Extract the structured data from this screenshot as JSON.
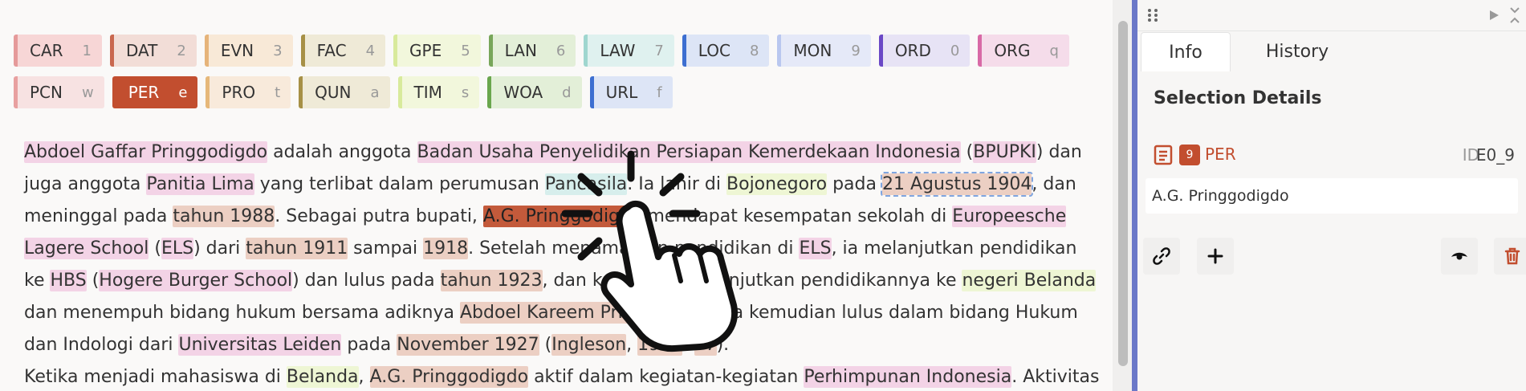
{
  "labels": [
    [
      {
        "name": "CAR",
        "key": "1",
        "color": "#f7d6d6",
        "border": "#e59a9a"
      },
      {
        "name": "DAT",
        "key": "2",
        "color": "#f2ddd7",
        "border": "#c9684f"
      },
      {
        "name": "EVN",
        "key": "3",
        "color": "#f8e9d7",
        "border": "#e6b47a"
      },
      {
        "name": "FAC",
        "key": "4",
        "color": "#efead7",
        "border": "#a69046"
      },
      {
        "name": "GPE",
        "key": "5",
        "color": "#f2f7dc",
        "border": "#d8ea9c"
      },
      {
        "name": "LAN",
        "key": "6",
        "color": "#e3efd8",
        "border": "#78a65a"
      },
      {
        "name": "LAW",
        "key": "7",
        "color": "#dff1ef",
        "border": "#9fd6cf"
      },
      {
        "name": "LOC",
        "key": "8",
        "color": "#dde5f6",
        "border": "#3d6fd1"
      },
      {
        "name": "MON",
        "key": "9",
        "color": "#e5e9f8",
        "border": "#b9c7ef"
      },
      {
        "name": "ORD",
        "key": "0",
        "color": "#e7e3f5",
        "border": "#6a48c6"
      },
      {
        "name": "ORG",
        "key": "q",
        "color": "#f5dcea",
        "border": "#d86aa6"
      }
    ],
    [
      {
        "name": "PCN",
        "key": "w",
        "color": "#f7e2e2",
        "border": "#e8a0a0"
      },
      {
        "name": "PER",
        "key": "e",
        "color": "#c24e2f",
        "border": "#c24e2f",
        "selected": true
      },
      {
        "name": "PRO",
        "key": "t",
        "color": "#f8eadb",
        "border": "#e6b87a"
      },
      {
        "name": "QUN",
        "key": "a",
        "color": "#efead7",
        "border": "#a69046"
      },
      {
        "name": "TIM",
        "key": "s",
        "color": "#f2f7dc",
        "border": "#d8ea9c"
      },
      {
        "name": "WOA",
        "key": "d",
        "color": "#e3efd8",
        "border": "#6aa64e"
      },
      {
        "name": "URL",
        "key": "f",
        "color": "#dde5f6",
        "border": "#3d6fd1"
      }
    ]
  ],
  "text": {
    "l1": [
      "Abdoel Gaffar Pringgodigdo",
      " adalah anggota ",
      "Badan Usaha Penyelidikan Persiapan Kemerdekaan Indonesia",
      " (",
      "BPUPKI",
      ") dan"
    ],
    "l2": [
      "juga anggota ",
      "Panitia Lima",
      " yang terlibat dalam perumusan ",
      "Pancasila",
      ". Ia lahir di ",
      "Bojonegoro",
      " pada ",
      "21 Agustus 1904",
      ", dan"
    ],
    "l3": [
      "meninggal pada ",
      "tahun 1988",
      ". Sebagai putra bupati, ",
      "A.G. Pringgodigdo",
      " mendapat kesempatan sekolah di ",
      "Europeesche"
    ],
    "l4": [
      "Lagere School",
      " (",
      "ELS",
      ") dari ",
      "tahun 1911",
      " sampai ",
      "1918",
      ". Setelah menamatkan pendidikan di ",
      "ELS",
      ", ia melanjutkan pendidikan"
    ],
    "l5": [
      "ke ",
      "HBS",
      " (",
      "Hogere Burger School",
      ") dan lulus pada ",
      "tahun 1923",
      ", dan kemudian melanjutkan pendidikannya ke ",
      "negeri Belanda"
    ],
    "l6": [
      "dan menempuh bidang hukum bersama adiknya ",
      "Abdoel Kareem Pringgodigdo",
      ". Ia kemudian lulus dalam bidang Hukum"
    ],
    "l7": [
      "dan Indologi dari ",
      "Universitas Leiden",
      " pada ",
      "November 1927",
      " (",
      "Ingleson",
      ", ",
      "1993",
      ": ",
      "77",
      ")."
    ],
    "l8": [
      "Ketika menjadi mahasiswa di ",
      "Belanda",
      ", ",
      "A.G. Pringgodigdo",
      " aktif dalam kegiatan-kegiatan ",
      "Perhimpunan Indonesia",
      ". Aktivitas"
    ]
  },
  "panel": {
    "tabs": [
      "Info",
      "History"
    ],
    "section_title": "Selection Details",
    "region_number": "9",
    "region_label": "PER",
    "id_prefix": "ID",
    "id_value": "E0_9",
    "selected_text": "A.G. Pringgodigdo"
  },
  "icons": {
    "drag": "drag-handle-icon",
    "play": "play-icon",
    "collapse": "collapse-icon",
    "link": "link-icon",
    "add": "plus-icon",
    "visibility": "eye-icon",
    "delete": "trash-icon",
    "region": "list-icon"
  }
}
